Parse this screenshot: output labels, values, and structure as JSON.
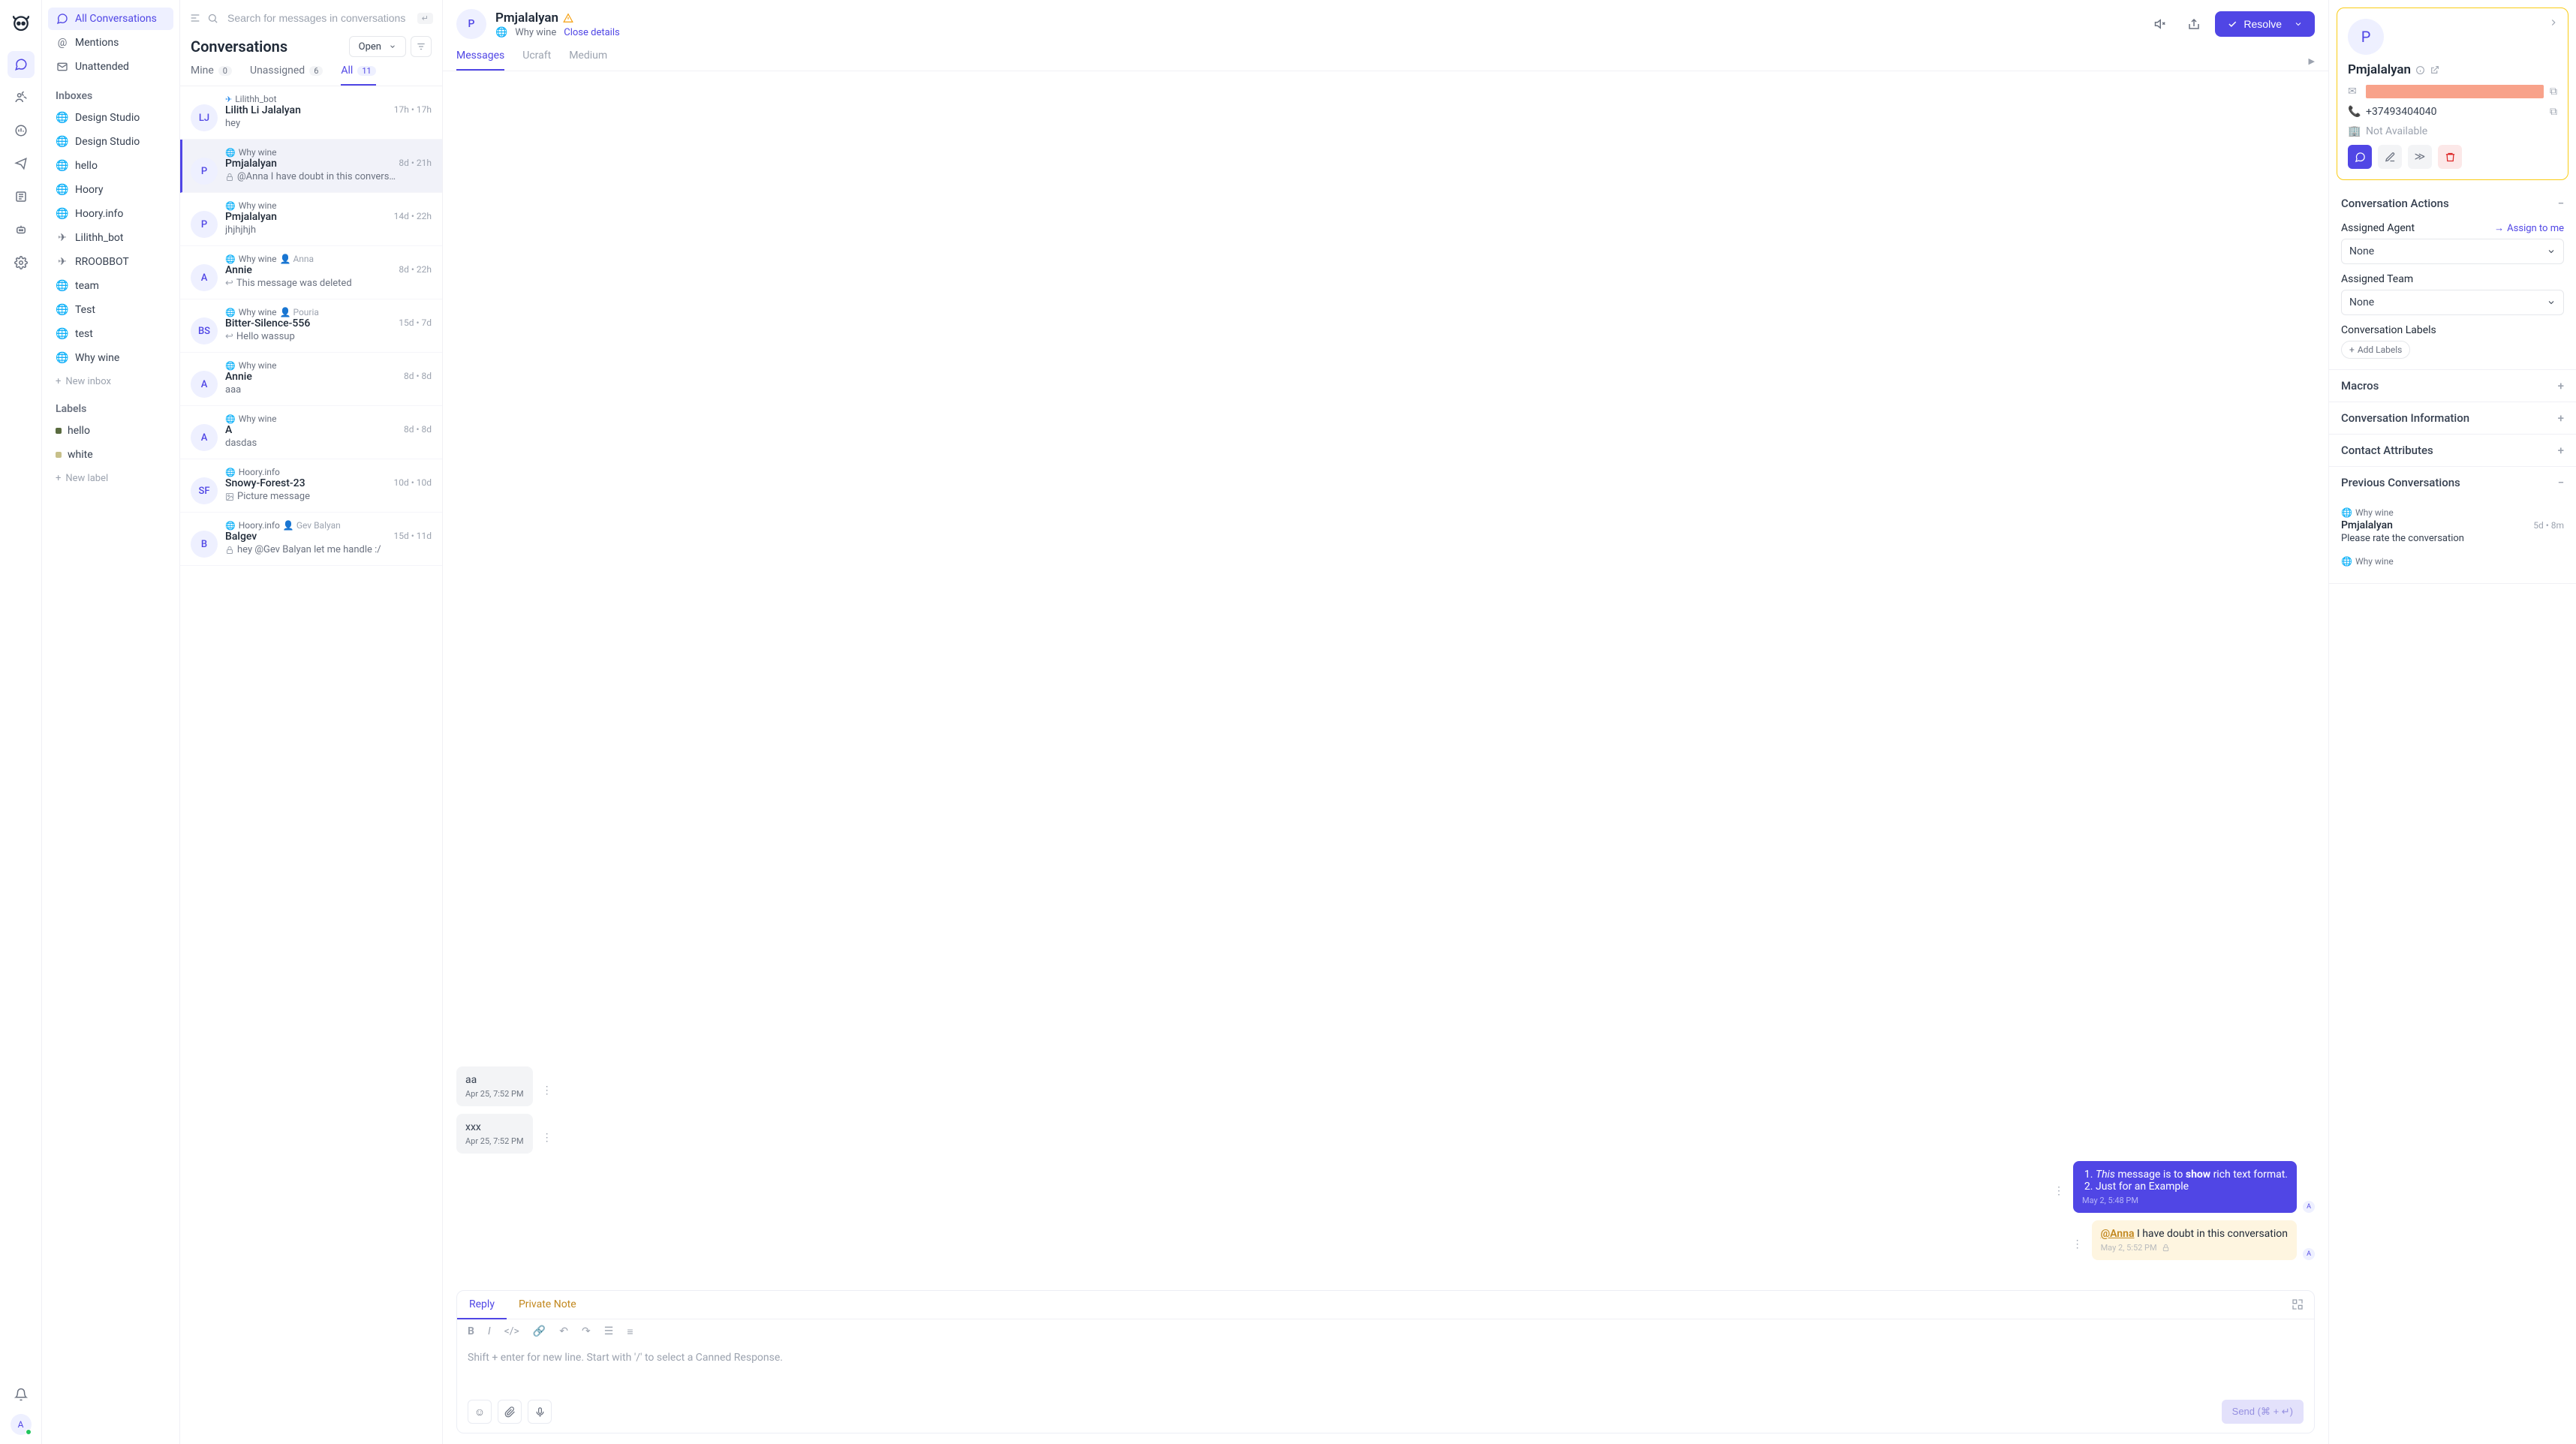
{
  "sidebar": {
    "all_conversations": "All Conversations",
    "mentions": "Mentions",
    "unattended": "Unattended",
    "inboxes_title": "Inboxes",
    "inboxes": [
      "Design Studio",
      "Design Studio",
      "hello",
      "Hoory",
      "Hoory.info",
      "Lilithh_bot",
      "RROOBBOT",
      "team",
      "Test",
      "test",
      "Why wine"
    ],
    "new_inbox": "New inbox",
    "labels_title": "Labels",
    "labels": [
      {
        "name": "hello",
        "color": "#5a6b3f"
      },
      {
        "name": "white",
        "color": "#c7c08a"
      }
    ],
    "new_label": "New label"
  },
  "list": {
    "search_placeholder": "Search for messages in conversations",
    "kbd": "↵",
    "title": "Conversations",
    "open": "Open",
    "tabs": {
      "mine": "Mine",
      "mine_n": "0",
      "unassigned": "Unassigned",
      "unassigned_n": "6",
      "all": "All",
      "all_n": "11"
    },
    "items": [
      {
        "avatar": "LJ",
        "inbox": "Lilithh_bot",
        "inbox_icon": "telegram",
        "name": "Lilith Li Jalalyan",
        "preview": "hey",
        "meta": "17h • 17h",
        "icon": ""
      },
      {
        "avatar": "P",
        "inbox": "Why wine",
        "inbox_icon": "web",
        "name": "Pmjalalyan",
        "preview": "@Anna I have doubt in this convers…",
        "meta": "8d • 21h",
        "icon": "lock",
        "selected": true
      },
      {
        "avatar": "P",
        "inbox": "Why wine",
        "inbox_icon": "web",
        "name": "Pmjalalyan",
        "preview": "jhjhjhjh",
        "meta": "14d • 22h",
        "icon": ""
      },
      {
        "avatar": "A",
        "inbox": "Why wine",
        "inbox_icon": "web",
        "name": "Annie",
        "preview": "This message was deleted",
        "meta": "8d • 22h",
        "icon": "reply",
        "assignee": "Anna"
      },
      {
        "avatar": "BS",
        "inbox": "Why wine",
        "inbox_icon": "web",
        "name": "Bitter-Silence-556",
        "preview": "Hello wassup",
        "meta": "15d • 7d",
        "icon": "reply",
        "assignee": "Pouria"
      },
      {
        "avatar": "A",
        "inbox": "Why wine",
        "inbox_icon": "web",
        "name": "Annie",
        "preview": "aaa",
        "meta": "8d • 8d",
        "icon": ""
      },
      {
        "avatar": "A",
        "inbox": "Why wine",
        "inbox_icon": "web",
        "name": "A",
        "preview": "dasdas",
        "meta": "8d • 8d",
        "icon": ""
      },
      {
        "avatar": "SF",
        "inbox": "Hoory.info",
        "inbox_icon": "web",
        "name": "Snowy-Forest-23",
        "preview": "Picture message",
        "meta": "10d • 10d",
        "icon": "pic"
      },
      {
        "avatar": "B",
        "inbox": "Hoory.info",
        "inbox_icon": "web",
        "name": "Balgev",
        "preview": "hey @Gev Balyan let me handle :/",
        "meta": "15d • 11d",
        "icon": "lock",
        "assignee": "Gev Balyan"
      }
    ]
  },
  "chat": {
    "name": "Pmjalalyan",
    "inbox": "Why wine",
    "close": "Close details",
    "resolve": "Resolve",
    "tabs": [
      "Messages",
      "Ucraft",
      "Medium"
    ],
    "messages": [
      {
        "dir": "in",
        "text": "aa",
        "time": "Apr 25, 7:52 PM"
      },
      {
        "dir": "in",
        "text": "xxx",
        "time": "Apr 25, 7:52 PM"
      },
      {
        "dir": "out",
        "html": "<ol style='padding-left:18px;'><li><i>This</i> message is to <b>show</b> rich text format.</li><li>Just for an Example</li></ol>",
        "time": "May 2, 5:48 PM"
      },
      {
        "dir": "note",
        "html": "<span class='mention'>@Anna</span> I have doubt in this conversation",
        "time": "May 2, 5:52 PM",
        "lock": true
      }
    ],
    "reply": {
      "reply_tab": "Reply",
      "note_tab": "Private Note",
      "placeholder": "Shift + enter for new line. Start with '/' to select a Canned Response.",
      "send": "Send (⌘ + ↵)"
    }
  },
  "contact": {
    "name": "Pmjalalyan",
    "phone": "+37493404040",
    "company": "Not Available",
    "actions_title": "Conversation Actions",
    "assigned_agent": "Assigned Agent",
    "assign_to_me": "Assign to me",
    "assigned_team": "Assigned Team",
    "none": "None",
    "labels_title": "Conversation Labels",
    "add_labels": "Add Labels",
    "macros": "Macros",
    "info": "Conversation Information",
    "attrs": "Contact Attributes",
    "prev": "Previous Conversations",
    "prev_items": [
      {
        "inbox": "Why wine",
        "name": "Pmjalalyan",
        "preview": "Please rate the conversation",
        "meta": "5d • 8m"
      },
      {
        "inbox": "Why wine"
      }
    ]
  }
}
